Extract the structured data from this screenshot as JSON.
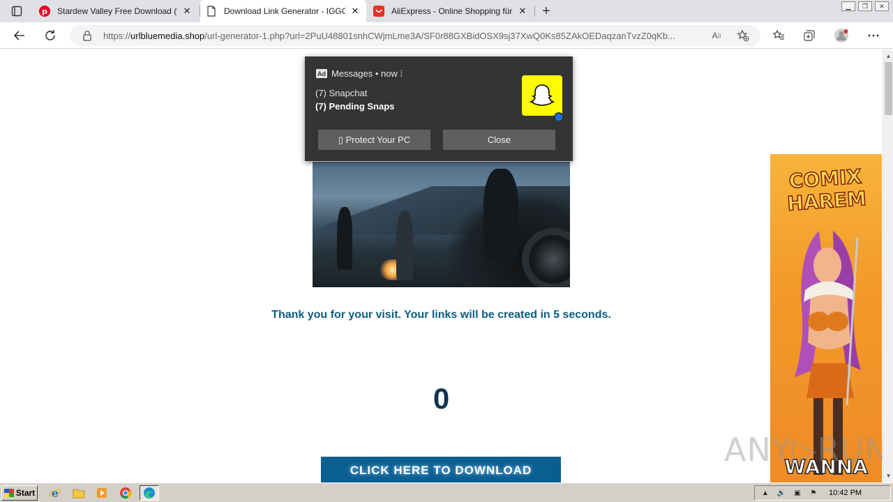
{
  "browser": {
    "tabs": [
      {
        "title": "Stardew Valley Free Download (v1",
        "icon": "pinterest-icon",
        "active": false
      },
      {
        "title": "Download Link Generator - IGGG",
        "icon": "page-icon",
        "active": true
      },
      {
        "title": "AliExpress - Online Shopping für",
        "icon": "aliexpress-icon",
        "active": false
      }
    ],
    "new_tab_label": "+",
    "close_glyph": "✕",
    "url_prefix": "https://",
    "url_domain": "urlbluemedia.shop",
    "url_path": "/url-generator-1.php?url=2PuU48801snhCWjmLme3A/SF0r88GXBidOSX9sj37XwQ0Ks85ZAkOEDaqzanTvzZ0qKb..."
  },
  "notification": {
    "ad_badge": "Ad",
    "header": "Messages • now ⁞",
    "line1": "(7) Snapchat",
    "line2": "(7) Pending Snaps",
    "protect_label": "▯ Protect Your PC",
    "close_label": "Close"
  },
  "page": {
    "thanks_text": "Thank you for your visit. Your links will be created in 5 seconds.",
    "counter": "0",
    "download_label": "CLICK HERE TO DOWNLOAD"
  },
  "side_ad": {
    "title": "COMIX HAREM",
    "cta": "WANNA"
  },
  "watermark": "ANY▷RUN",
  "taskbar": {
    "start_label": "Start",
    "clock": "10:42 PM"
  },
  "colors": {
    "accent_text": "#0b5d84",
    "button_bg": "#0b5e91",
    "snapchat_yellow": "#fffc00"
  }
}
